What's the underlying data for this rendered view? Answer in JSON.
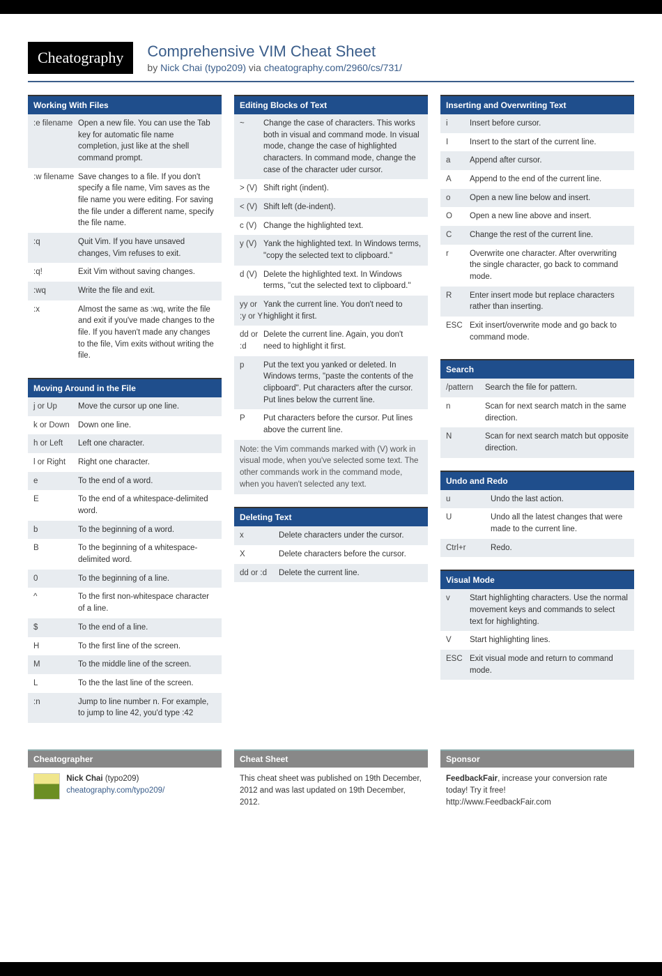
{
  "logo": "Cheatography",
  "title": "Comprehensive VIM Cheat Sheet",
  "byline_pre": "by ",
  "author": "Nick Chai (typo209)",
  "byline_mid": " via ",
  "via": "cheatography.com/2960/cs/731/",
  "col1": [
    {
      "title": "Working With Files",
      "keyw": "64",
      "rows": [
        {
          "k": ":e filename",
          "d": "Open a new file. You can use the Tab key for automatic file name completion, just like at the shell command prompt."
        },
        {
          "k": ":w filename",
          "d": "Save changes to a file. If you don't specify a file name, Vim saves as the file name you were editing. For saving the file under a different name, specify the file name."
        },
        {
          "k": ":q",
          "d": "Quit Vim. If you have unsaved changes, Vim refuses to exit."
        },
        {
          "k": ":q!",
          "d": "Exit Vim without saving changes."
        },
        {
          "k": ":wq",
          "d": "Write the file and exit."
        },
        {
          "k": ":x",
          "d": "Almost the same as :wq, write the file and exit if you've made changes to the file. If you haven't made any changes to the file, Vim exits without writing the file."
        }
      ]
    },
    {
      "title": "Moving Around in the File",
      "keyw": "40",
      "rows": [
        {
          "k": "j or Up",
          "d": "Move the cursor up one line."
        },
        {
          "k": "k or Down",
          "d": "Down one line."
        },
        {
          "k": "h or Left",
          "d": "Left one character."
        },
        {
          "k": "l or Right",
          "d": "Right one character."
        },
        {
          "k": "e",
          "d": "To the end of a word."
        },
        {
          "k": "E",
          "d": "To the end of a whitespace-delimited word."
        },
        {
          "k": "b",
          "d": "To the beginning of a word."
        },
        {
          "k": "B",
          "d": "To the beginning of a whitespace-delimited word."
        },
        {
          "k": "0",
          "d": "To the beginning of a line."
        },
        {
          "k": "^",
          "d": "To the first non-whitespace character of a line."
        },
        {
          "k": "$",
          "d": "To the end of a line."
        },
        {
          "k": "H",
          "d": "To the first line of the screen."
        },
        {
          "k": "M",
          "d": "To the middle line of the screen."
        },
        {
          "k": "L",
          "d": "To the the last line of the screen."
        },
        {
          "k": ":n",
          "d": "Jump to line number n. For example, to jump to line 42, you'd type :42"
        }
      ]
    }
  ],
  "col2": [
    {
      "title": "Editing Blocks of Text",
      "keyw": "34",
      "rows": [
        {
          "k": "~",
          "d": "Change the case of characters. This works both in visual and command mode. In visual mode, change the case of highlighted characters. In command mode, change the case of the character uder cursor."
        },
        {
          "k": "> (V)",
          "d": "Shift right (indent)."
        },
        {
          "k": "< (V)",
          "d": "Shift left (de-indent)."
        },
        {
          "k": "c (V)",
          "d": "Change the highlighted text."
        },
        {
          "k": "y (V)",
          "d": "Yank the highlighted text. In Windows terms, \"copy the selected text to clipboard.\""
        },
        {
          "k": "d (V)",
          "d": "Delete the highlighted text. In Windows terms, \"cut the selected text to clipboard.\""
        },
        {
          "k": "yy or :y or Y",
          "d": "Yank the current line. You don't need to highlight it first."
        },
        {
          "k": "dd or :d",
          "d": "Delete the current line. Again, you don't need to highlight it first."
        },
        {
          "k": "p",
          "d": "Put the text you yanked or deleted. In Windows terms, \"paste the contents of the clipboard\". Put characters after the cursor. Put lines below the current line."
        },
        {
          "k": "P",
          "d": "Put characters before the cursor. Put lines above the current line."
        }
      ],
      "note": "Note: the Vim commands marked with (V) work in visual mode, when you've selected some text. The other commands work in the command mode, when you haven't selected any text."
    },
    {
      "title": "Deleting Text",
      "keyw": "56",
      "rows": [
        {
          "k": "x",
          "d": "Delete characters under the cursor."
        },
        {
          "k": "X",
          "d": "Delete characters before the cursor."
        },
        {
          "k": "dd or :d",
          "d": "Delete the current line."
        }
      ]
    }
  ],
  "col3": [
    {
      "title": "Inserting and Overwriting Text",
      "keyw": "34",
      "rows": [
        {
          "k": "i",
          "d": "Insert before cursor."
        },
        {
          "k": "I",
          "d": "Insert to the start of the current line."
        },
        {
          "k": "a",
          "d": "Append after cursor."
        },
        {
          "k": "A",
          "d": "Append to the end of the current line."
        },
        {
          "k": "o",
          "d": "Open a new line below and insert."
        },
        {
          "k": "O",
          "d": "Open a new line above and insert."
        },
        {
          "k": "C",
          "d": "Change the rest of the current line."
        },
        {
          "k": "r",
          "d": "Overwrite one character. After overwriting the single character, go back to command mode."
        },
        {
          "k": "R",
          "d": "Enter insert mode but replace characters rather than inserting."
        },
        {
          "k": "ESC",
          "d": "Exit insert/overwrite mode and go back to command mode."
        }
      ]
    },
    {
      "title": "Search",
      "keyw": "56",
      "rows": [
        {
          "k": "/pattern",
          "d": "Search the file for pattern."
        },
        {
          "k": "n",
          "d": "Scan for next search match in the same direction."
        },
        {
          "k": "N",
          "d": "Scan for next search match but opposite direction."
        }
      ]
    },
    {
      "title": "Undo and Redo",
      "keyw": "40",
      "rows": [
        {
          "k": "u",
          "d": "Undo the last action."
        },
        {
          "k": "U",
          "d": "Undo all the latest changes that were made to the current line."
        },
        {
          "k": "Ctrl+r",
          "d": "Redo."
        }
      ]
    },
    {
      "title": "Visual Mode",
      "keyw": "34",
      "rows": [
        {
          "k": "v",
          "d": "Start highlighting characters. Use the normal movement keys and commands to select text for highlighting."
        },
        {
          "k": "V",
          "d": "Start highlighting lines."
        },
        {
          "k": "ESC",
          "d": "Exit visual mode and return to command mode."
        }
      ]
    }
  ],
  "footer": {
    "cheatographer": {
      "title": "Cheatographer",
      "name": "Nick Chai",
      "handle": "(typo209)",
      "url": "cheatography.com/typo209/"
    },
    "cheatsheet": {
      "title": "Cheat Sheet",
      "text": "This cheat sheet was published on 19th December, 2012 and was last updated on 19th December, 2012."
    },
    "sponsor": {
      "title": "Sponsor",
      "bold": "FeedbackFair",
      "text": ", increase your conversion rate today! Try it free!",
      "url": "http://www.FeedbackFair.com"
    }
  }
}
